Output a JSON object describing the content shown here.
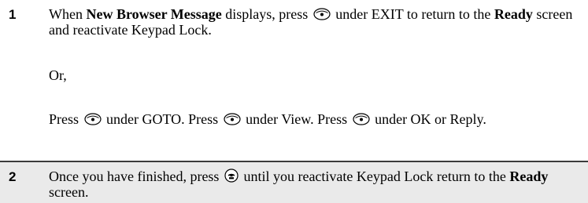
{
  "steps": [
    {
      "number": "1",
      "para1": {
        "t1": "When ",
        "b1": "New Browser Message",
        "t2": " displays, press ",
        "t3": " under EXIT to return to the ",
        "b2": "Ready",
        "t4": " screen and reactivate Keypad Lock."
      },
      "para2": "Or,",
      "para3": {
        "t1": "Press ",
        "t2": " under GOTO. Press ",
        "t3": " under View. Press ",
        "t4": " under OK or Reply."
      }
    },
    {
      "number": "2",
      "para1": {
        "t1": "Once you have finished, press ",
        "t2": " until you reactivate Keypad Lock return to the ",
        "b1": "Ready",
        "t3": " screen."
      }
    }
  ],
  "icons": {
    "select_key": "select-key-icon",
    "end_key": "end-key-icon"
  }
}
